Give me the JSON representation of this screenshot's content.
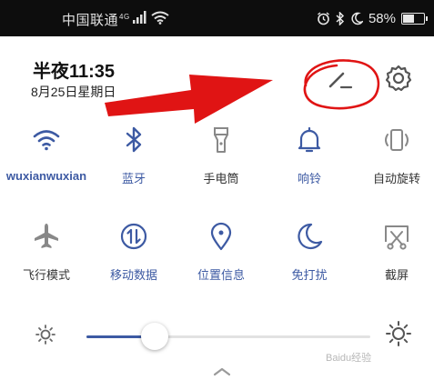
{
  "status_bar": {
    "carrier": "中国联通",
    "network_type": "4G",
    "battery": "58%",
    "battery_level": 0.58,
    "icons": [
      "signal-icon",
      "wifi-icon",
      "alarm-icon",
      "bluetooth-icon",
      "moon-icon",
      "battery-icon"
    ]
  },
  "header": {
    "time": "半夜11:35",
    "date": "8月25日星期日",
    "edit_icon": "pencil-icon",
    "settings_icon": "gear-icon"
  },
  "tiles_row1": [
    {
      "label": "wuxianwuxian",
      "icon": "wifi-icon",
      "active": true
    },
    {
      "label": "蓝牙",
      "icon": "bluetooth-icon",
      "active": true
    },
    {
      "label": "手电筒",
      "icon": "flashlight-icon",
      "active": false
    },
    {
      "label": "响铃",
      "icon": "bell-icon",
      "active": true
    },
    {
      "label": "自动旋转",
      "icon": "rotate-icon",
      "active": false
    }
  ],
  "tiles_row2": [
    {
      "label": "飞行模式",
      "icon": "airplane-icon",
      "active": false
    },
    {
      "label": "移动数据",
      "icon": "mobile-data-icon",
      "active": true
    },
    {
      "label": "位置信息",
      "icon": "location-icon",
      "active": true
    },
    {
      "label": "免打扰",
      "icon": "moon-icon",
      "active": true
    },
    {
      "label": "截屏",
      "icon": "screenshot-icon",
      "active": false
    }
  ],
  "brightness": {
    "level": 0.24
  },
  "watermark": "Baidu经验",
  "colors": {
    "active": "#3d5aa3",
    "inactive": "#888888",
    "annotation": "#e01414"
  }
}
